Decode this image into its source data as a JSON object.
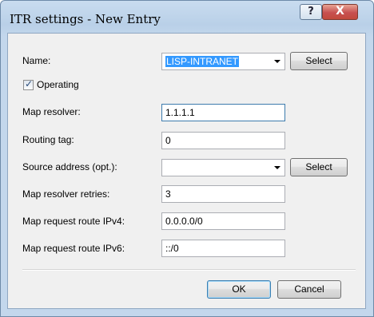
{
  "window": {
    "title": "ITR settings - New Entry",
    "help_label": "?",
    "close_label": "X"
  },
  "form": {
    "name_label": "Name:",
    "name_value": "LISP-INTRANET",
    "select_label": "Select",
    "operating_label": "Operating",
    "operating_checked": true,
    "check_glyph": "✓",
    "map_resolver_label": "Map resolver:",
    "map_resolver_value": "1.1.1.1",
    "routing_tag_label": "Routing tag:",
    "routing_tag_value": "0",
    "source_address_label": "Source address (opt.):",
    "source_address_value": "",
    "source_select_label": "Select",
    "retries_label": "Map resolver retries:",
    "retries_value": "3",
    "route_ipv4_label": "Map request route IPv4:",
    "route_ipv4_value": "0.0.0.0/0",
    "route_ipv6_label": "Map request route IPv6:",
    "route_ipv6_value": "::/0"
  },
  "footer": {
    "ok_label": "OK",
    "cancel_label": "Cancel"
  }
}
